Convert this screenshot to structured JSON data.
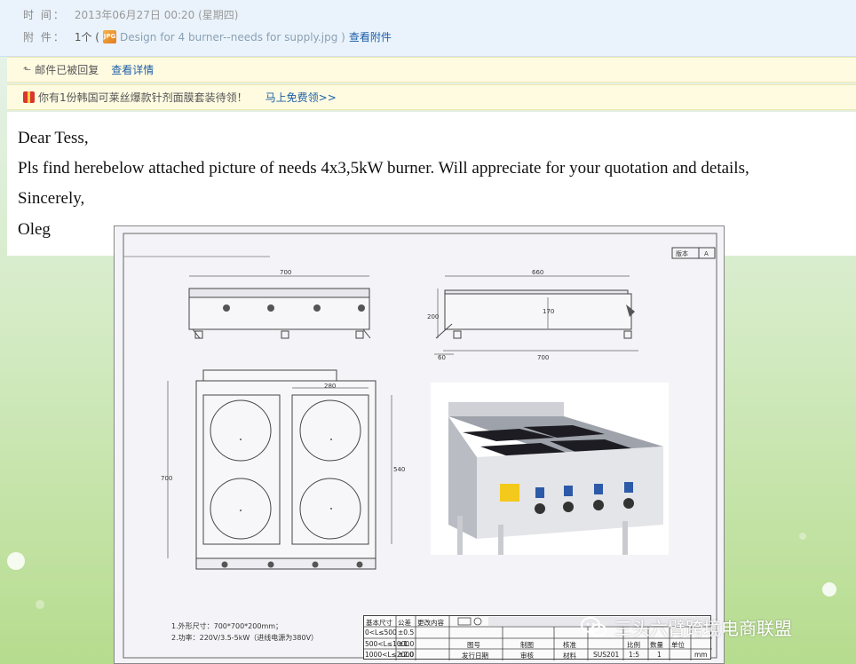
{
  "meta": {
    "time_label": "时 间：",
    "time_value": "2013年06月27日 00:20 (星期四)",
    "attach_label": "附 件：",
    "attach_count": "1个 (",
    "file_name": "Design for 4 burner--needs for supply.jpg )",
    "view_attachments": "查看附件"
  },
  "notice": {
    "replied_text": "邮件已被回复",
    "view_details": "查看详情",
    "promo_text": "你有1份韩国可莱丝爆款针剂面膜套装待领！",
    "promo_link": "马上免费领>>"
  },
  "email": {
    "greeting": "Dear Tess,",
    "body": "Pls find herebelow attached picture of needs 4x3,5kW burner. Will appreciate for your quotation and details,",
    "closing": "Sincerely,",
    "signature": "Oleg"
  },
  "drawing": {
    "version_label": "版本",
    "version_value": "A",
    "dims": {
      "front_width": "700",
      "side_width_top": "660",
      "side_height": "200",
      "side_mid": "170",
      "side_depth_small": "60",
      "side_bottom": "700",
      "top_left": "700",
      "top_inner": "280",
      "top_right": "540"
    },
    "notes": [
      "1.外形尺寸：700*700*200mm；",
      "2.功率：220V/3.5-5kW（进线电源为380V）"
    ],
    "title_block": {
      "c1": "基本尺寸",
      "c2": "公差",
      "c3": "更改内容",
      "r1": "0<L≤500",
      "r1v": "±0.5",
      "r2": "500<L≤1000",
      "r2v": "±1.0",
      "r3": "1000<L≤2000",
      "r3v": "±2.0",
      "drawing_no": "图号",
      "issue_date": "发行日期",
      "draw": "制图",
      "review": "审核",
      "check": "核准",
      "material": "材料",
      "material_value": "SUS201",
      "scale": "比例",
      "scale_value": "1:5",
      "qty": "数量",
      "qty_value": "1",
      "unit": "单位",
      "unit_value": "mm"
    }
  },
  "watermark": {
    "text": "三头六臂跨境电商联盟"
  }
}
